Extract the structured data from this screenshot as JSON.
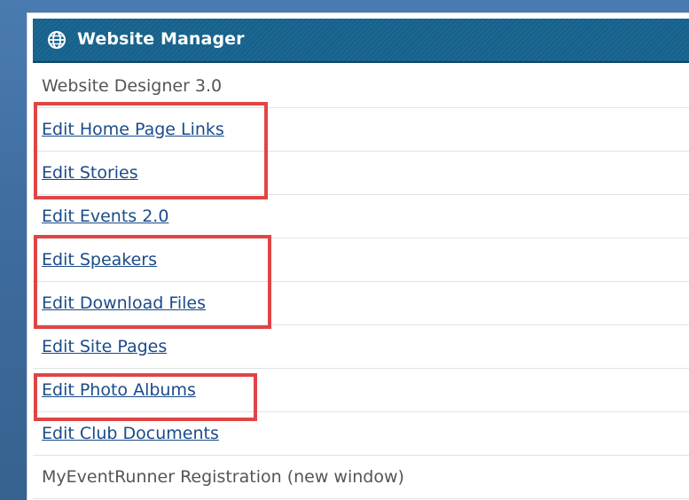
{
  "panel": {
    "title": "Website Manager",
    "title_icon": "globe-icon"
  },
  "menu": {
    "items": [
      {
        "label": "Website Designer 3.0",
        "type": "text"
      },
      {
        "label": "Edit Home Page Links",
        "type": "link"
      },
      {
        "label": "Edit Stories",
        "type": "link"
      },
      {
        "label": "Edit Events 2.0",
        "type": "link"
      },
      {
        "label": "Edit Speakers",
        "type": "link"
      },
      {
        "label": "Edit Download Files",
        "type": "link"
      },
      {
        "label": "Edit Site Pages",
        "type": "link"
      },
      {
        "label": "Edit Photo Albums",
        "type": "link"
      },
      {
        "label": "Edit Club Documents",
        "type": "link"
      },
      {
        "label": "MyEventRunner Registration (new window)",
        "type": "text"
      }
    ]
  },
  "colors": {
    "header_bg": "#16628d",
    "link": "#1b4b8a",
    "highlight": "#e04545",
    "page_bg": "#3f6ea3"
  }
}
